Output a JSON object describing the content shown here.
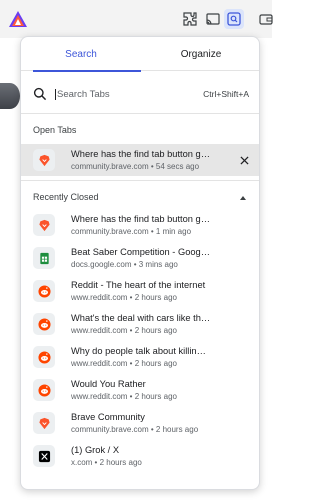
{
  "toolbar": {
    "icons": [
      "brave-logo-icon",
      "extensions-icon",
      "cast-icon",
      "tab-search-icon",
      "wallet-icon"
    ]
  },
  "popup": {
    "tabs": [
      {
        "label": "Search",
        "active": true
      },
      {
        "label": "Organize",
        "active": false
      }
    ],
    "search": {
      "placeholder": "Search Tabs",
      "shortcut": "Ctrl+Shift+A"
    },
    "open_tabs": {
      "label": "Open Tabs",
      "items": [
        {
          "title": "Where has the find tab button go...",
          "meta": "community.brave.com • 54 secs ago",
          "icon": "brave"
        }
      ]
    },
    "recently_closed": {
      "label": "Recently Closed",
      "items": [
        {
          "title": "Where has the find tab button gone? I ...",
          "meta": "community.brave.com • 1 min ago",
          "icon": "brave"
        },
        {
          "title": "Beat Saber Competition - Google Sheets",
          "meta": "docs.google.com • 3 mins ago",
          "icon": "sheets"
        },
        {
          "title": "Reddit - The heart of the internet",
          "meta": "www.reddit.com • 2 hours ago",
          "icon": "reddit"
        },
        {
          "title": "What's the deal with cars like this that ...",
          "meta": "www.reddit.com • 2 hours ago",
          "icon": "reddit"
        },
        {
          "title": "Why do people talk about killing baby...",
          "meta": "www.reddit.com • 2 hours ago",
          "icon": "reddit"
        },
        {
          "title": "Would You Rather",
          "meta": "www.reddit.com • 2 hours ago",
          "icon": "reddit"
        },
        {
          "title": "Brave Community",
          "meta": "community.brave.com • 2 hours ago",
          "icon": "brave"
        },
        {
          "title": "(1) Grok / X",
          "meta": "x.com • 2 hours ago",
          "icon": "x"
        }
      ]
    }
  },
  "colors": {
    "accent": "#3d56d9",
    "brave": "#fb542b",
    "reddit": "#ff4500",
    "sheets": "#1e8e3e"
  }
}
